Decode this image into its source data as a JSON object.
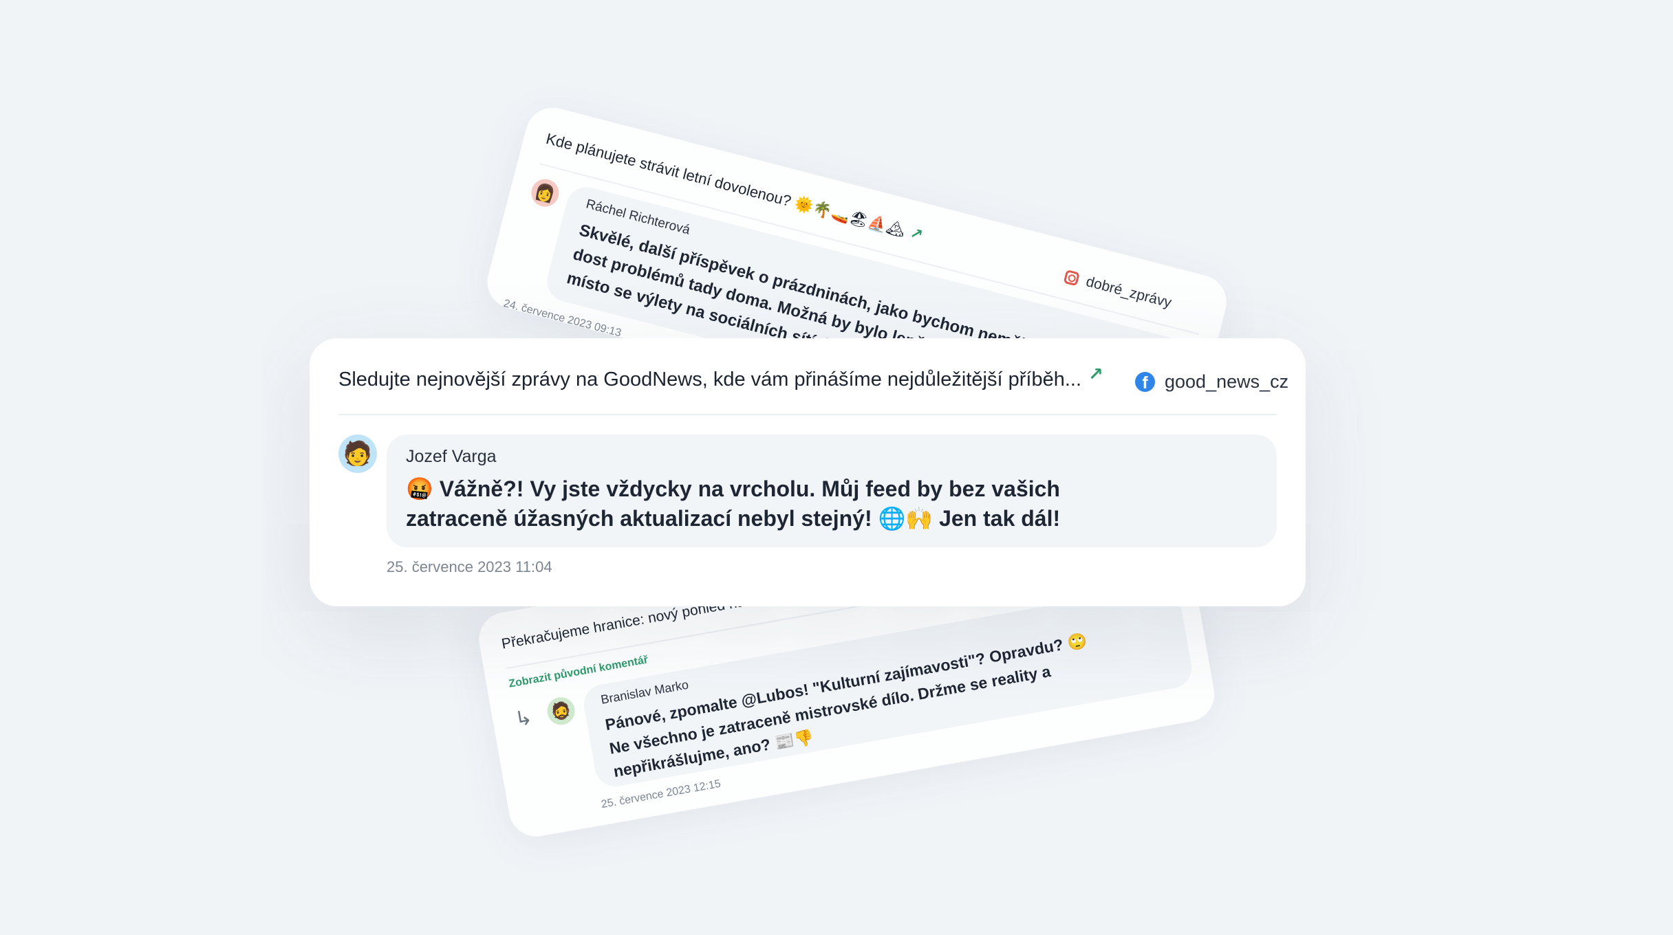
{
  "cards": {
    "top": {
      "post_text": "Kde plánujete strávit letní dovolenou? 🌞🌴🚤🏖⛵🏔",
      "source_handle": "dobré_zprávy",
      "source_icon": "instagram-icon",
      "author": "Ráchel Richterová",
      "comment": "Skvělé, další příspěvek o prázdninách, jako bychom neměli dost problémů tady doma. Možná by bylo lepší, kdybyste místo se výlety na sociálních sítích trávili čas řešením 🤬!",
      "timestamp": "24. července 2023 09:13"
    },
    "main": {
      "post_text": "Sledujte nejnovější zprávy na GoodNews, kde vám přinášíme nejdůležitější příběh...",
      "source_handle": "good_news_cz",
      "source_icon": "facebook-icon",
      "author": "Jozef Varga",
      "comment_line1": "🤬 Vážně?! Vy jste vždycky na vrcholu. Můj feed by bez vašich",
      "comment_line2": "zatraceně úžasných aktualizací nebyl stejný! 🌐🙌 Jen tak dál!",
      "timestamp": "25. července 2023 11:04"
    },
    "bottom": {
      "post_text": "Překračujeme hranice: nový pohled na ku",
      "show_original_link": "Zobrazit původní komentář",
      "author": "Branislav Marko",
      "comment": "Pánové, zpomalte @Lubos! \"Kulturní zajímavosti\"? Opravdu? 🙄 Ne všechno je zatraceně mistrovské dílo. Držme se reality a nepřikrášlujme, ano? 📰👎",
      "timestamp": "25. července 2023 12:15"
    }
  },
  "colors": {
    "background": "#f1f4f7",
    "accent_green": "#2f9b6d",
    "facebook_blue": "#2f86e8",
    "instagram_red": "#e0584e",
    "bubble": "#f2f5f8"
  }
}
